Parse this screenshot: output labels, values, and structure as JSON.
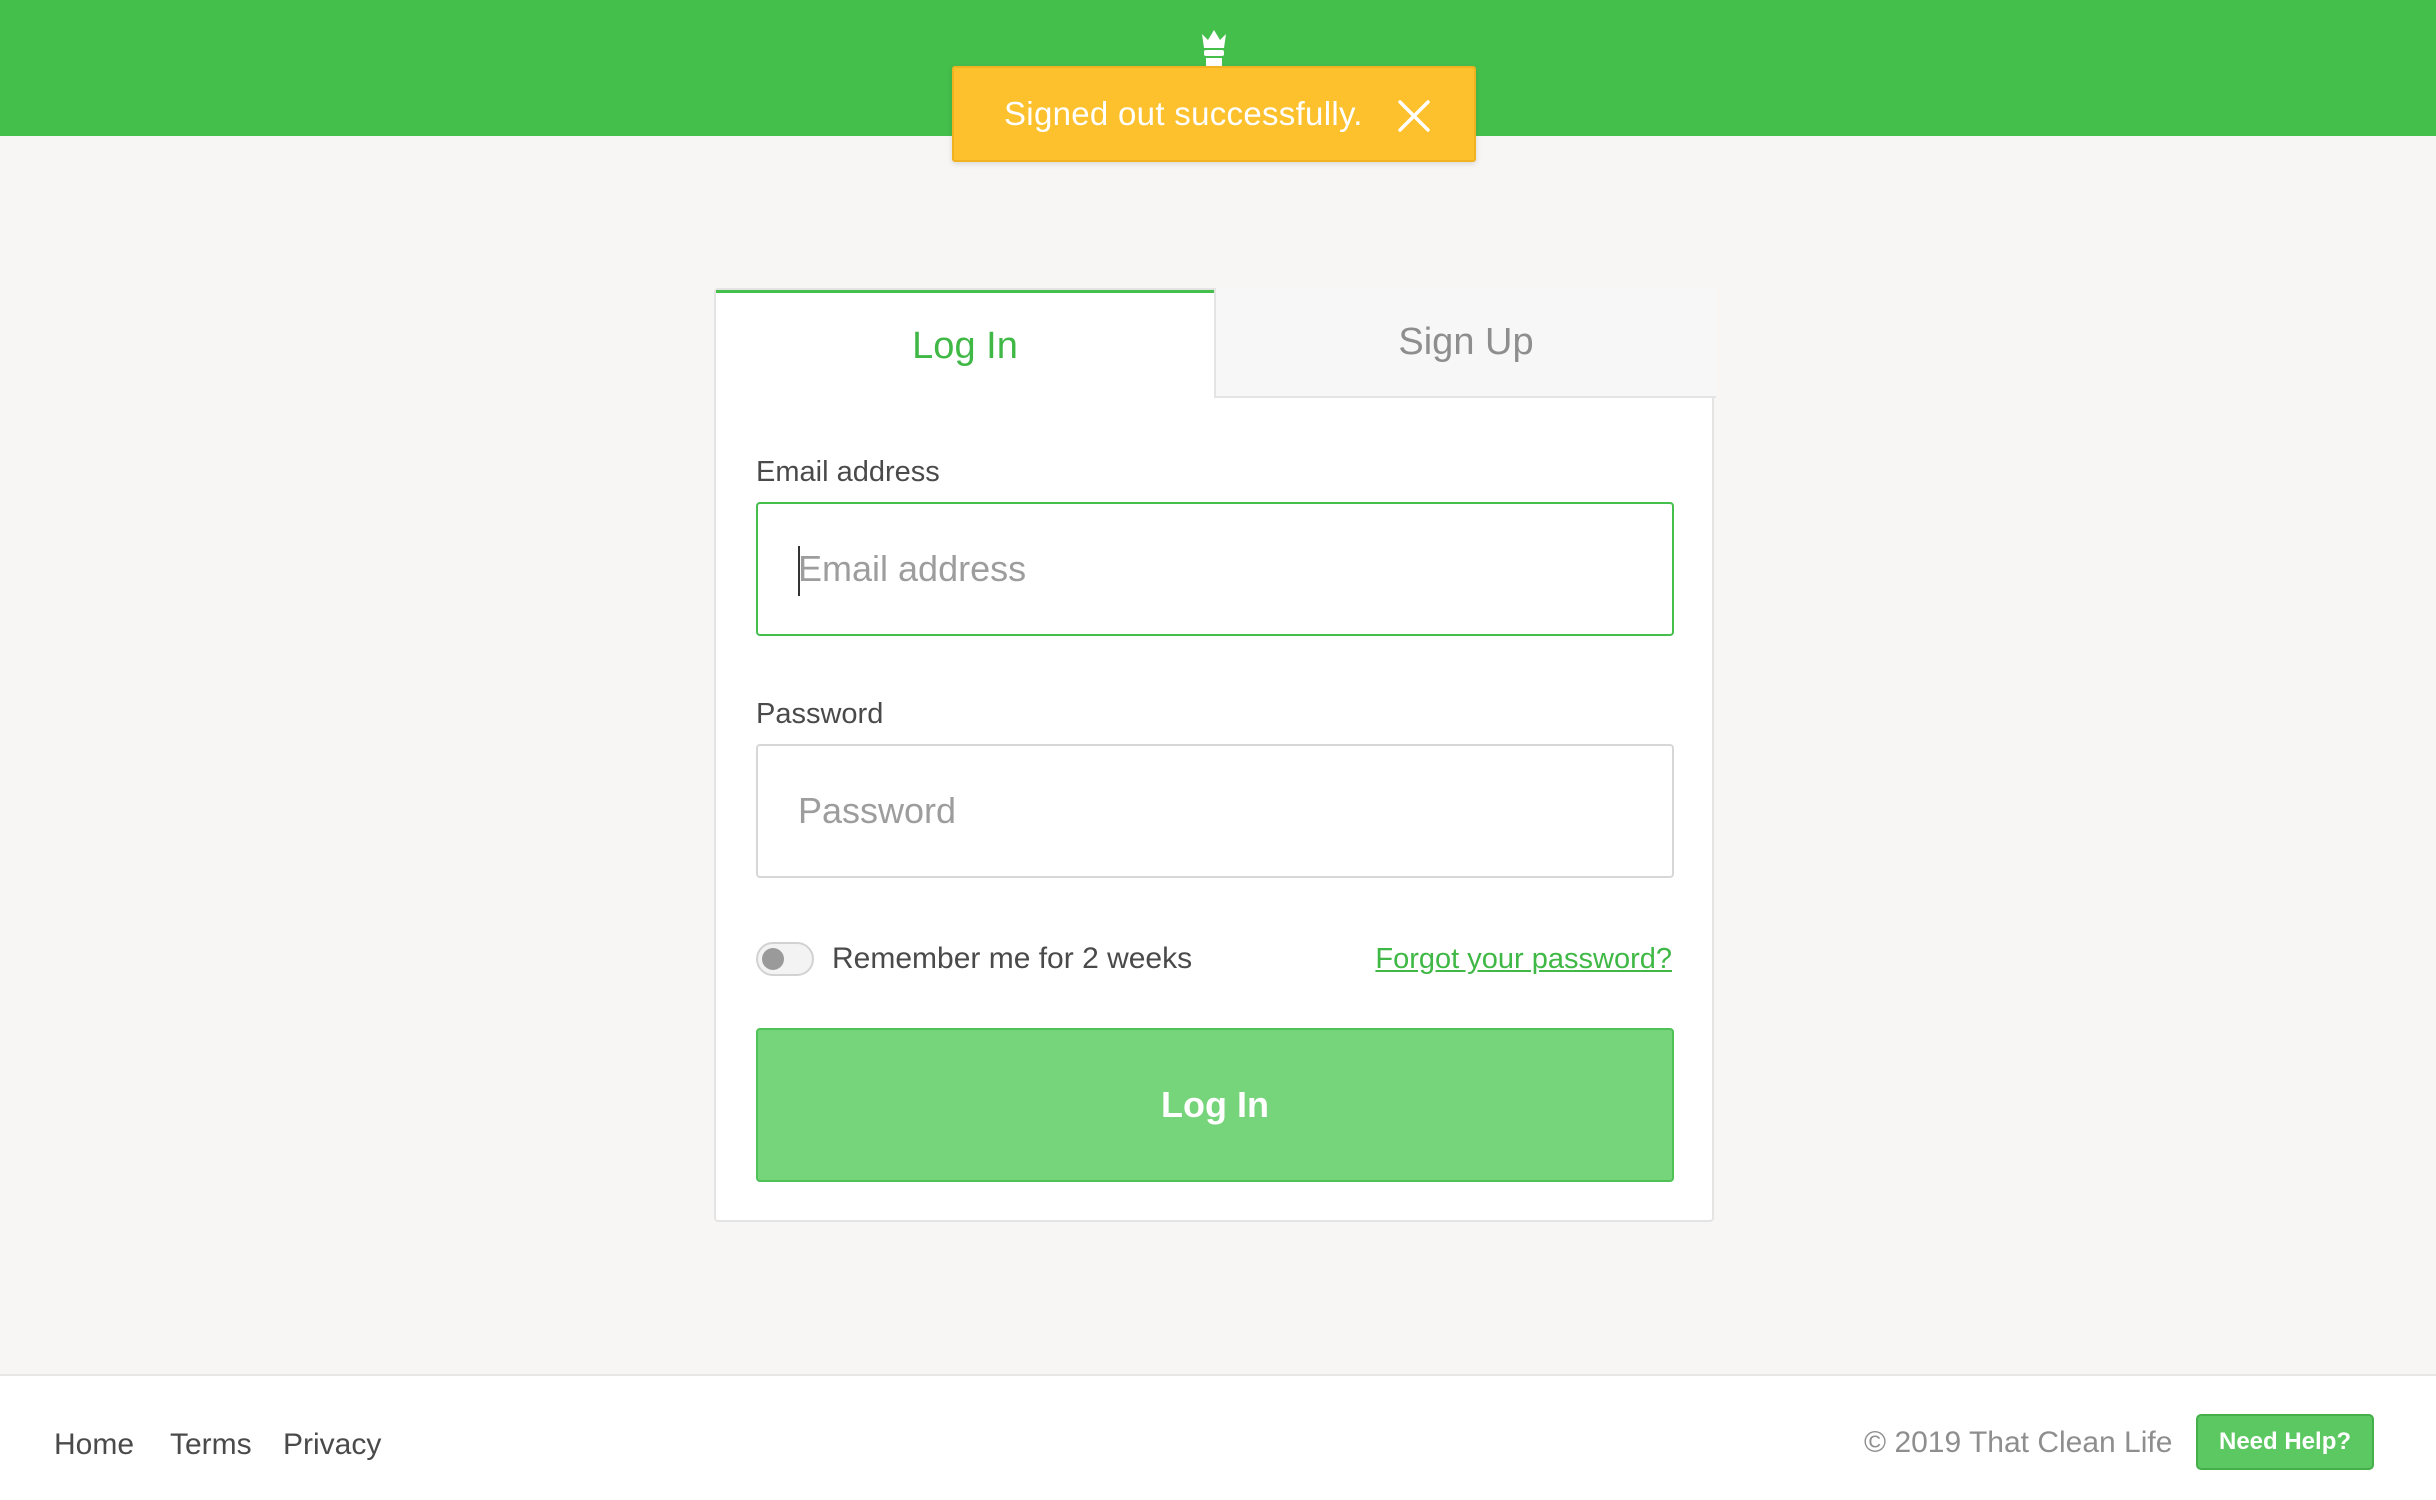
{
  "header": {
    "logo_icon": "chef-hat-icon",
    "brand_color": "#45bf4c"
  },
  "toast": {
    "message": "Signed out successfully.",
    "close_icon": "close-icon",
    "color": "#fcc12d"
  },
  "auth_card": {
    "tabs": [
      {
        "label": "Log In",
        "active": true
      },
      {
        "label": "Sign Up",
        "active": false
      }
    ],
    "email": {
      "label": "Email address",
      "placeholder": "Email address",
      "value": ""
    },
    "password": {
      "label": "Password",
      "placeholder": "Password",
      "value": ""
    },
    "remember_me": {
      "label": "Remember me for 2 weeks",
      "checked": false
    },
    "forgot_password": "Forgot your password?",
    "submit_label": "Log In"
  },
  "footer": {
    "links": [
      "Home",
      "Terms",
      "Privacy"
    ],
    "copyright": "© 2019 That Clean Life",
    "help_label": "Need Help?"
  }
}
